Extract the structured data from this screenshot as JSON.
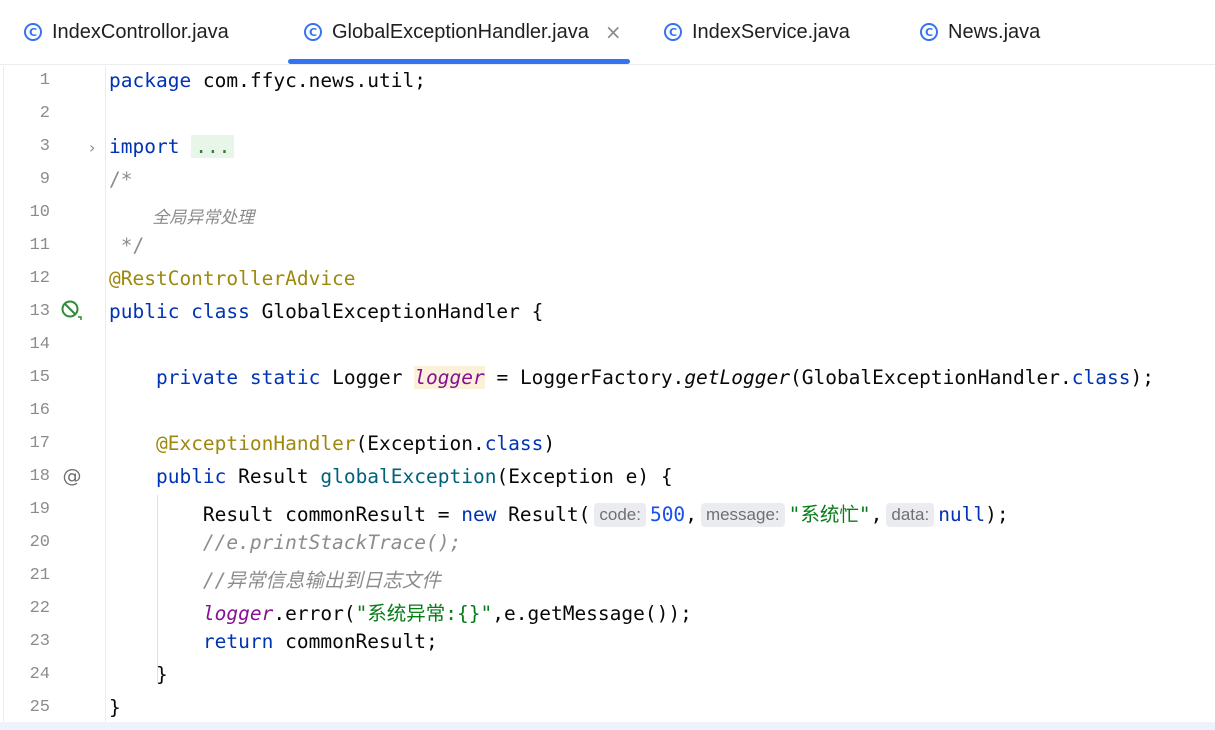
{
  "tabs": [
    {
      "label": "IndexControllor.java",
      "active": false,
      "icon": "class-icon"
    },
    {
      "label": "GlobalExceptionHandler.java",
      "active": true,
      "icon": "class-icon",
      "close": "×"
    },
    {
      "label": "IndexService.java",
      "active": false,
      "icon": "class-icon"
    },
    {
      "label": "News.java",
      "active": false,
      "icon": "class-icon"
    }
  ],
  "tab_icon_glyph": "C",
  "gutter": {
    "fold_chevron": "›",
    "line_numbers": [
      "1",
      "2",
      "3",
      "9",
      "10",
      "11",
      "12",
      "13",
      "14",
      "15",
      "16",
      "17",
      "18",
      "19",
      "20",
      "21",
      "22",
      "23",
      "24",
      "25"
    ]
  },
  "code": {
    "l1": {
      "kw": "package",
      "rest": " com.ffyc.news.util;"
    },
    "l3": {
      "kw": "import",
      "dots": "..."
    },
    "l9": "/*",
    "l10": "        全局异常处理",
    "l11": " */",
    "l12": "@RestControllerAdvice",
    "l13": {
      "kw": "public class",
      "rest": " GlobalExceptionHandler {"
    },
    "l15": {
      "kw": "private static",
      "type": " Logger ",
      "field": "logger",
      "mid": " = LoggerFactory.",
      "call": "getLogger",
      "args": "(GlobalExceptionHandler.",
      "cls": "class",
      "end": ");"
    },
    "l17": {
      "ann": "@ExceptionHandler",
      "args": "(Exception.",
      "cls": "class",
      "end": ")"
    },
    "l18": {
      "kw": "public",
      "type": " Result ",
      "method": "globalException",
      "rest": "(Exception e) {"
    },
    "l19": {
      "start": "Result commonResult = ",
      "kw": "new",
      "call": " Result(",
      "hint_code": "code:",
      "code_val": "500",
      "hint_message": "message:",
      "message_val": "\"系统忙\"",
      "hint_data": "data:",
      "data_val": "null",
      "end": ");"
    },
    "l20": "//e.printStackTrace();",
    "l21": "//异常信息输出到日志文件",
    "l22": {
      "field": "logger",
      "call": ".error(",
      "str": "\"系统异常:{}\"",
      "rest": ",e.getMessage());"
    },
    "l23": {
      "kw": "return",
      "rest": " commonResult;"
    },
    "l24": "}",
    "l25": "}"
  }
}
